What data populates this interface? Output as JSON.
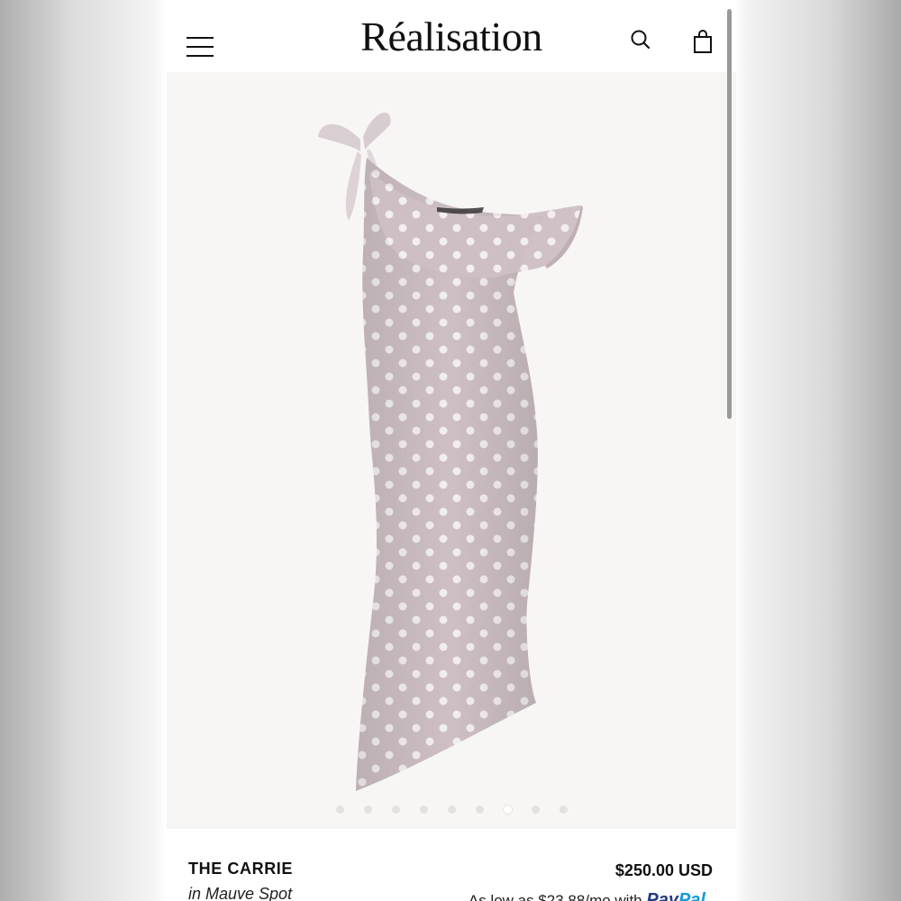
{
  "header": {
    "brand": "Réalisation",
    "menu_icon": "hamburger-menu-icon",
    "search_icon": "search-icon",
    "cart_icon": "shopping-bag-icon"
  },
  "product": {
    "image_alt": "One-shoulder polka dot slip dress with tie shoulder and ruffle",
    "dress_color": "#cdbfc3",
    "dot_color": "#f3eef0",
    "carousel": {
      "total": 9,
      "active_index": 6
    },
    "name": "THE CARRIE",
    "variant": "in Mauve Spot",
    "price": "$250.00 USD",
    "installment_text": "As low as $23.88/mo with",
    "paypal_part1": "Pay",
    "paypal_part2": "Pal"
  }
}
